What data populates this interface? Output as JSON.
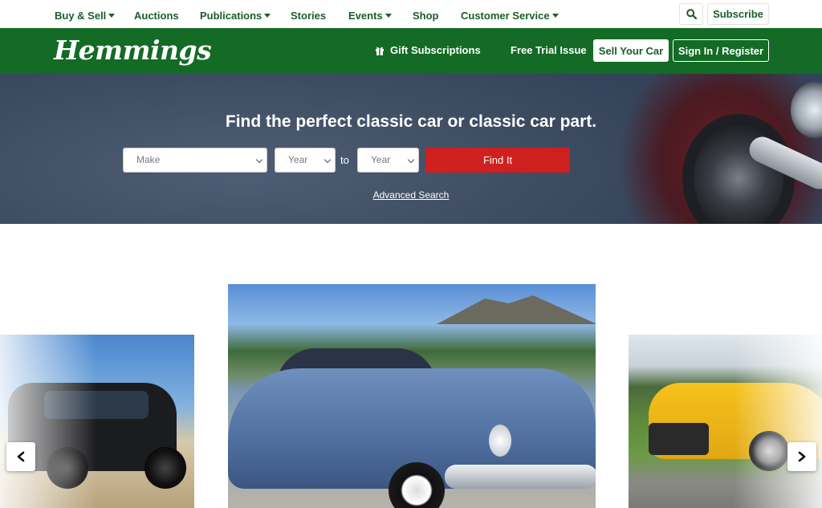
{
  "topnav": {
    "items": [
      {
        "label": "Buy & Sell",
        "dropdown": true
      },
      {
        "label": "Auctions",
        "dropdown": false
      },
      {
        "label": "Publications",
        "dropdown": true
      },
      {
        "label": "Stories",
        "dropdown": false
      },
      {
        "label": "Events",
        "dropdown": true
      },
      {
        "label": "Shop",
        "dropdown": false
      },
      {
        "label": "Customer Service",
        "dropdown": true
      }
    ],
    "search_icon": "search-icon",
    "subscribe_label": "Subscribe"
  },
  "header": {
    "logo_text": "Hemmings",
    "gift_label": "Gift Subscriptions",
    "gift_icon": "gift-icon",
    "free_trial_label": "Free Trial Issue",
    "sell_label": "Sell Your Car",
    "signin_label": "Sign In / Register"
  },
  "hero": {
    "title": "Find the perfect classic car or classic car part.",
    "make_placeholder": "Make",
    "year_from_placeholder": "Year",
    "to_label": "to",
    "year_to_placeholder": "Year",
    "find_label": "Find It",
    "advanced_label": "Advanced Search"
  },
  "carousel": {
    "prev_icon": "chevron-left-icon",
    "next_icon": "chevron-right-icon"
  },
  "colors": {
    "brand_green": "#146b25",
    "nav_green": "#1a5d2a",
    "find_red": "#d01f1f"
  }
}
